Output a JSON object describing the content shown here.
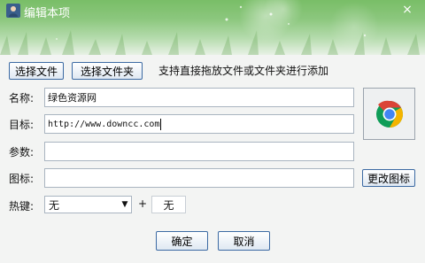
{
  "window": {
    "title": "编辑本项",
    "close_glyph": "×"
  },
  "toolbar": {
    "select_file_label": "选择文件",
    "select_folder_label": "选择文件夹",
    "drag_note": "支持直接拖放文件或文件夹进行添加"
  },
  "form": {
    "name_label": "名称:",
    "name_value": "绿色资源网",
    "target_label": "目标:",
    "target_value": "http://www.downcc.com",
    "params_label": "参数:",
    "params_value": "",
    "icon_label": "图标:",
    "icon_value": "",
    "change_icon_label": "更改图标",
    "hotkey_label": "热键:",
    "hotkey_modifier": "无",
    "hotkey_plus": "+",
    "hotkey_key": "无"
  },
  "preview": {
    "icon": "chrome-icon"
  },
  "actions": {
    "ok_label": "确定",
    "cancel_label": "取消"
  },
  "colors": {
    "titlebar": "#79be67",
    "button_border": "#3c6aa3",
    "chrome_red": "#db4437",
    "chrome_green": "#0f9d58",
    "chrome_yellow": "#f4b400",
    "chrome_blue": "#4285f4"
  }
}
